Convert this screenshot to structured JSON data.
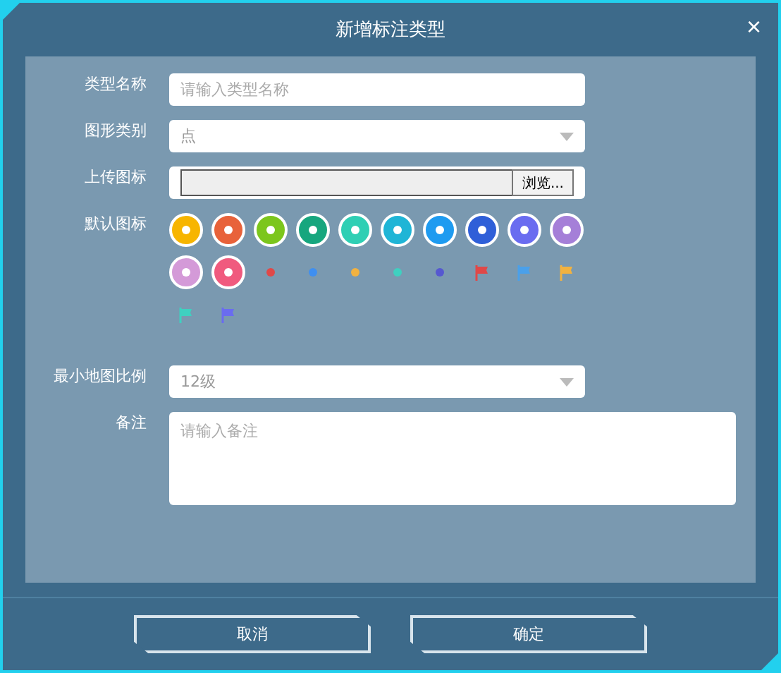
{
  "dialog": {
    "title": "新增标注类型",
    "close": "×"
  },
  "form": {
    "name": {
      "label": "类型名称",
      "placeholder": "请输入类型名称"
    },
    "shape": {
      "label": "图形类别",
      "value": "点"
    },
    "upload": {
      "label": "上传图标",
      "button": "浏览..."
    },
    "icons": {
      "label": "默认图标",
      "items": [
        {
          "kind": "badge",
          "color": "#f7b500"
        },
        {
          "kind": "badge",
          "color": "#e8623a"
        },
        {
          "kind": "badge",
          "color": "#7cc61c"
        },
        {
          "kind": "badge",
          "color": "#17a67e"
        },
        {
          "kind": "badge",
          "color": "#2fcfb4"
        },
        {
          "kind": "badge",
          "color": "#1fb5d6"
        },
        {
          "kind": "badge",
          "color": "#1e9bf0"
        },
        {
          "kind": "badge",
          "color": "#2f5fd8"
        },
        {
          "kind": "badge",
          "color": "#6a6cf0"
        },
        {
          "kind": "badge",
          "color": "#a57fd8"
        },
        {
          "kind": "badge",
          "color": "#d49ad8"
        },
        {
          "kind": "badge",
          "color": "#f05a7e"
        },
        {
          "kind": "dot",
          "color": "#e04848"
        },
        {
          "kind": "dot",
          "color": "#3f8ff0"
        },
        {
          "kind": "dot",
          "color": "#f2b240"
        },
        {
          "kind": "dot",
          "color": "#3fd0c0"
        },
        {
          "kind": "dot",
          "color": "#5658d0"
        },
        {
          "kind": "flag",
          "color": "#e04848"
        },
        {
          "kind": "flag",
          "color": "#4aa0ea"
        },
        {
          "kind": "flag",
          "color": "#f2b240"
        },
        {
          "kind": "flag",
          "color": "#3fd0c0"
        },
        {
          "kind": "flag",
          "color": "#6a6cf0"
        }
      ]
    },
    "scale": {
      "label": "最小地图比例",
      "value": "12级"
    },
    "remark": {
      "label": "备注",
      "placeholder": "请输入备注"
    }
  },
  "buttons": [
    {
      "label": "取消"
    },
    {
      "label": "确定"
    }
  ]
}
